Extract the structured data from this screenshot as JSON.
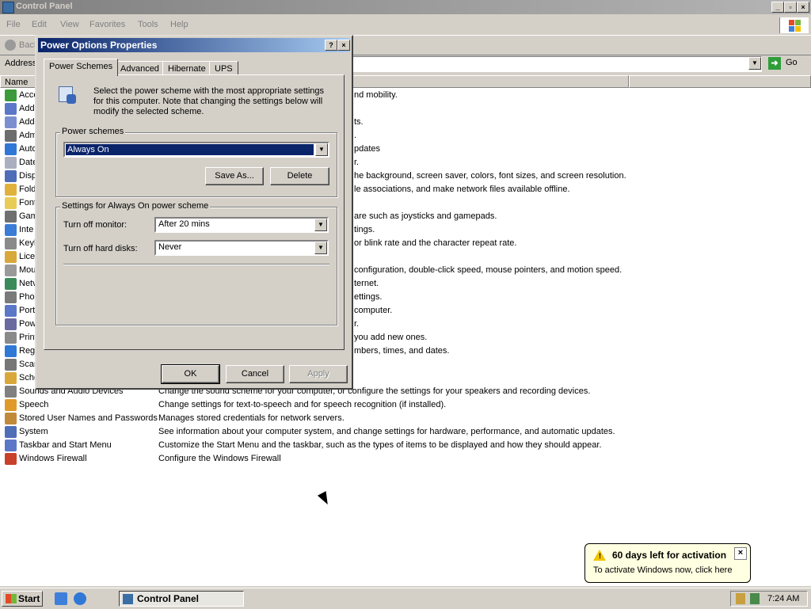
{
  "window": {
    "title": "Control Panel"
  },
  "menu": {
    "file": "File",
    "edit": "Edit",
    "view": "View",
    "favorites": "Favorites",
    "tools": "Tools",
    "help": "Help"
  },
  "toolbar": {
    "back": "Back"
  },
  "address": {
    "label": "Address",
    "go": "Go"
  },
  "list": {
    "name_header": "Name",
    "items": [
      {
        "name": "Acce",
        "desc": "nd mobility.",
        "color": "#3b9b3b"
      },
      {
        "name": "Add",
        "desc": "",
        "color": "#5b77c8"
      },
      {
        "name": "Add",
        "desc": "ts.",
        "color": "#7b8fd0"
      },
      {
        "name": "Adm",
        "desc": ".",
        "color": "#6d6d6d"
      },
      {
        "name": "Auto",
        "desc": "pdates",
        "color": "#2f78d6"
      },
      {
        "name": "Date",
        "desc": "r.",
        "color": "#aab0c0"
      },
      {
        "name": "Disp",
        "desc": "he background, screen saver, colors, font sizes, and screen resolution.",
        "color": "#4e6eb8"
      },
      {
        "name": "Fold",
        "desc": "le associations, and make network files available offline.",
        "color": "#e0b23c"
      },
      {
        "name": "Font",
        "desc": "",
        "color": "#e9cc56"
      },
      {
        "name": "Gam",
        "desc": "are such as joysticks and gamepads.",
        "color": "#707070"
      },
      {
        "name": "Inte",
        "desc": "tings.",
        "color": "#3b7cd6"
      },
      {
        "name": "Keyb",
        "desc": "or blink rate and the character repeat rate.",
        "color": "#8a8a8a"
      },
      {
        "name": "Licer",
        "desc": "",
        "color": "#d8a83a"
      },
      {
        "name": "Mou",
        "desc": "configuration, double-click speed, mouse pointers, and motion speed.",
        "color": "#9a9a9a"
      },
      {
        "name": "Netv",
        "desc": "ternet.",
        "color": "#3a8a5a"
      },
      {
        "name": "Phor",
        "desc": "ettings.",
        "color": "#7a7a7a"
      },
      {
        "name": "Port",
        "desc": "computer.",
        "color": "#5b77c8"
      },
      {
        "name": "Pow",
        "desc": "r.",
        "color": "#6a6aa0"
      },
      {
        "name": "Print",
        "desc": "you add new ones.",
        "color": "#8a8a8a"
      },
      {
        "name": "Regi",
        "desc": "mbers, times, and dates.",
        "color": "#2f78d6"
      },
      {
        "name": "Scar",
        "desc": "",
        "color": "#777777"
      },
      {
        "name": "Sche",
        "desc": "",
        "color": "#d8a83a"
      },
      {
        "name": "Sounds and Audio Devices",
        "desc": "Change the sound scheme for your computer, or configure the settings for your speakers and recording devices.",
        "color": "#808080"
      },
      {
        "name": "Speech",
        "desc": "Change settings for text-to-speech and for speech recognition (if installed).",
        "color": "#e09a2a"
      },
      {
        "name": "Stored User Names and Passwords",
        "desc": "Manages stored credentials for network servers.",
        "color": "#c08a3a"
      },
      {
        "name": "System",
        "desc": "See information about your computer system, and change settings for hardware, performance, and automatic updates.",
        "color": "#4e6eb8"
      },
      {
        "name": "Taskbar and Start Menu",
        "desc": "Customize the Start Menu and the taskbar, such as the types of items to be displayed and how they should appear.",
        "color": "#5b77c8"
      },
      {
        "name": "Windows Firewall",
        "desc": "Configure the Windows Firewall",
        "color": "#c8402a"
      }
    ]
  },
  "dialog": {
    "title": "Power Options Properties",
    "tabs": [
      "Power Schemes",
      "Advanced",
      "Hibernate",
      "UPS"
    ],
    "intro": "Select the power scheme with the most appropriate settings for this computer. Note that changing the settings below will modify the selected scheme.",
    "schemes_label": "Power schemes",
    "scheme_selected": "Always On",
    "save_as": "Save As...",
    "delete": "Delete",
    "settings_label": "Settings for Always On power scheme",
    "monitor_label": "Turn off monitor:",
    "monitor_value": "After 20 mins",
    "disks_label": "Turn off hard disks:",
    "disks_value": "Never",
    "ok": "OK",
    "cancel": "Cancel",
    "apply": "Apply"
  },
  "balloon": {
    "title": "60 days left for activation",
    "body": "To activate Windows now, click here"
  },
  "taskbar": {
    "start": "Start",
    "task": "Control Panel",
    "clock": "7:24 AM"
  }
}
